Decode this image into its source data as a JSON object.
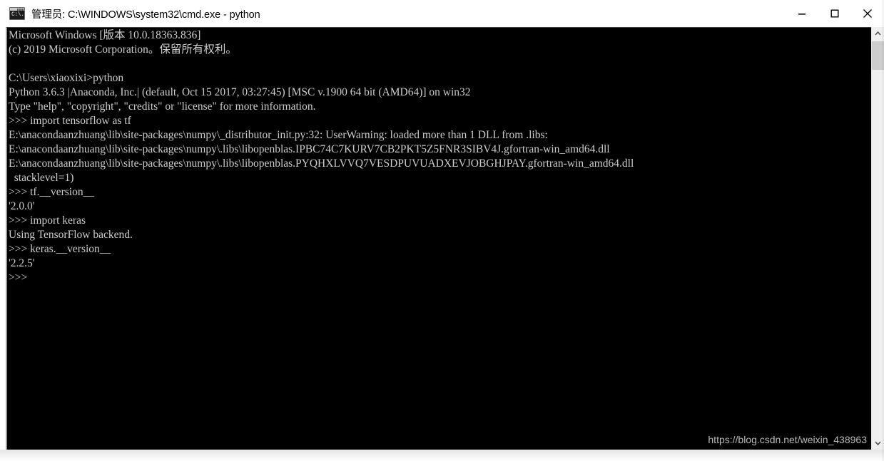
{
  "window": {
    "title": "管理员: C:\\WINDOWS\\system32\\cmd.exe - python",
    "icon_name": "cmd-console-icon",
    "icon_label": "C:\\.",
    "controls": {
      "minimize_label": "Minimize",
      "maximize_label": "Maximize",
      "close_label": "Close"
    }
  },
  "console": {
    "prompt": ">>>",
    "lines": [
      "Microsoft Windows [版本 10.0.18363.836]",
      "(c) 2019 Microsoft Corporation。保留所有权利。",
      "",
      "C:\\Users\\xiaoxixi>python",
      "Python 3.6.3 |Anaconda, Inc.| (default, Oct 15 2017, 03:27:45) [MSC v.1900 64 bit (AMD64)] on win32",
      "Type \"help\", \"copyright\", \"credits\" or \"license\" for more information.",
      ">>> import tensorflow as tf",
      "E:\\anacondaanzhuang\\lib\\site-packages\\numpy\\_distributor_init.py:32: UserWarning: loaded more than 1 DLL from .libs:",
      "E:\\anacondaanzhuang\\lib\\site-packages\\numpy\\.libs\\libopenblas.IPBC74C7KURV7CB2PKT5Z5FNR3SIBV4J.gfortran-win_amd64.dll",
      "E:\\anacondaanzhuang\\lib\\site-packages\\numpy\\.libs\\libopenblas.PYQHXLVVQ7VESDPUVUADXEVJOBGHJPAY.gfortran-win_amd64.dll",
      "  stacklevel=1)",
      ">>> tf.__version__",
      "'2.0.0'",
      ">>> import keras",
      "Using TensorFlow backend.",
      ">>> keras.__version__",
      "'2.2.5'",
      ">>>"
    ],
    "watermark": "https://blog.csdn.net/weixin_438963",
    "background_color": "#000000",
    "text_color": "#cccccc"
  },
  "scrollbar": {
    "up_arrow_name": "scroll-up-arrow",
    "down_arrow_name": "scroll-down-arrow",
    "thumb_name": "scroll-thumb"
  }
}
